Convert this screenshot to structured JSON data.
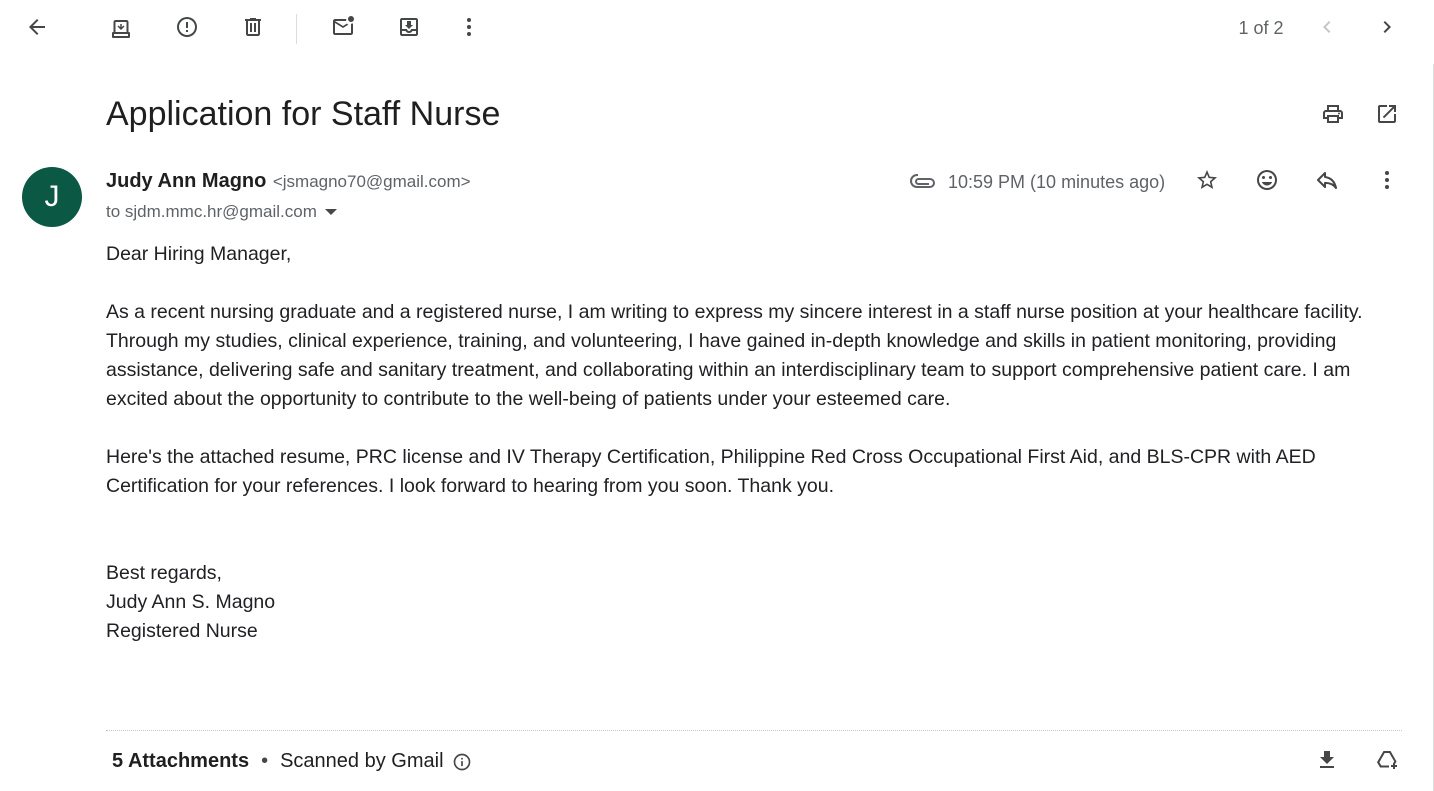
{
  "toolbar": {
    "back_icon": "arrow-left-icon",
    "archive_icon": "archive-icon",
    "spam_icon": "report-spam-icon",
    "delete_icon": "trash-icon",
    "mark_unread_icon": "mark-unread-icon",
    "move_icon": "move-to-inbox-icon",
    "more_icon": "more-vert-icon",
    "pager_text": "1 of 2",
    "prev_icon": "chevron-left-icon",
    "next_icon": "chevron-right-icon"
  },
  "email": {
    "subject": "Application for Staff Nurse",
    "print_icon": "print-icon",
    "open_new_window_icon": "open-in-new-icon",
    "avatar_letter": "J",
    "avatar_color": "#0b5945",
    "sender_name": "Judy Ann Magno",
    "sender_email": "<jsmagno70@gmail.com>",
    "to_line": "to sjdm.mmc.hr@gmail.com",
    "timestamp": "10:59 PM (10 minutes ago)",
    "attachment_icon": "paperclip-icon",
    "body": {
      "greeting": "Dear Hiring Manager,",
      "paragraph1": "As a recent nursing graduate and a registered nurse, I am writing to express my sincere interest in a staff nurse position at your healthcare facility. Through my studies, clinical experience, training, and volunteering, I have gained in-depth knowledge and skills in patient monitoring, providing assistance, delivering safe and sanitary treatment, and collaborating within an interdisciplinary team to support comprehensive patient care. I am excited about the opportunity to contribute to the well-being of patients under your esteemed care.",
      "paragraph2": "Here's the attached resume, PRC license and IV Therapy Certification, Philippine Red Cross Occupational First Aid, and BLS-CPR with AED Certification for your references. I look forward to hearing from you soon. Thank you.",
      "closing": "Best regards,",
      "signature_name": "Judy Ann S. Magno",
      "signature_title": "Registered Nurse"
    }
  },
  "attachments": {
    "count_label": "5 Attachments",
    "separator": "•",
    "scanned_label": "Scanned by Gmail",
    "download_icon": "download-icon",
    "drive_icon": "add-to-drive-icon"
  }
}
